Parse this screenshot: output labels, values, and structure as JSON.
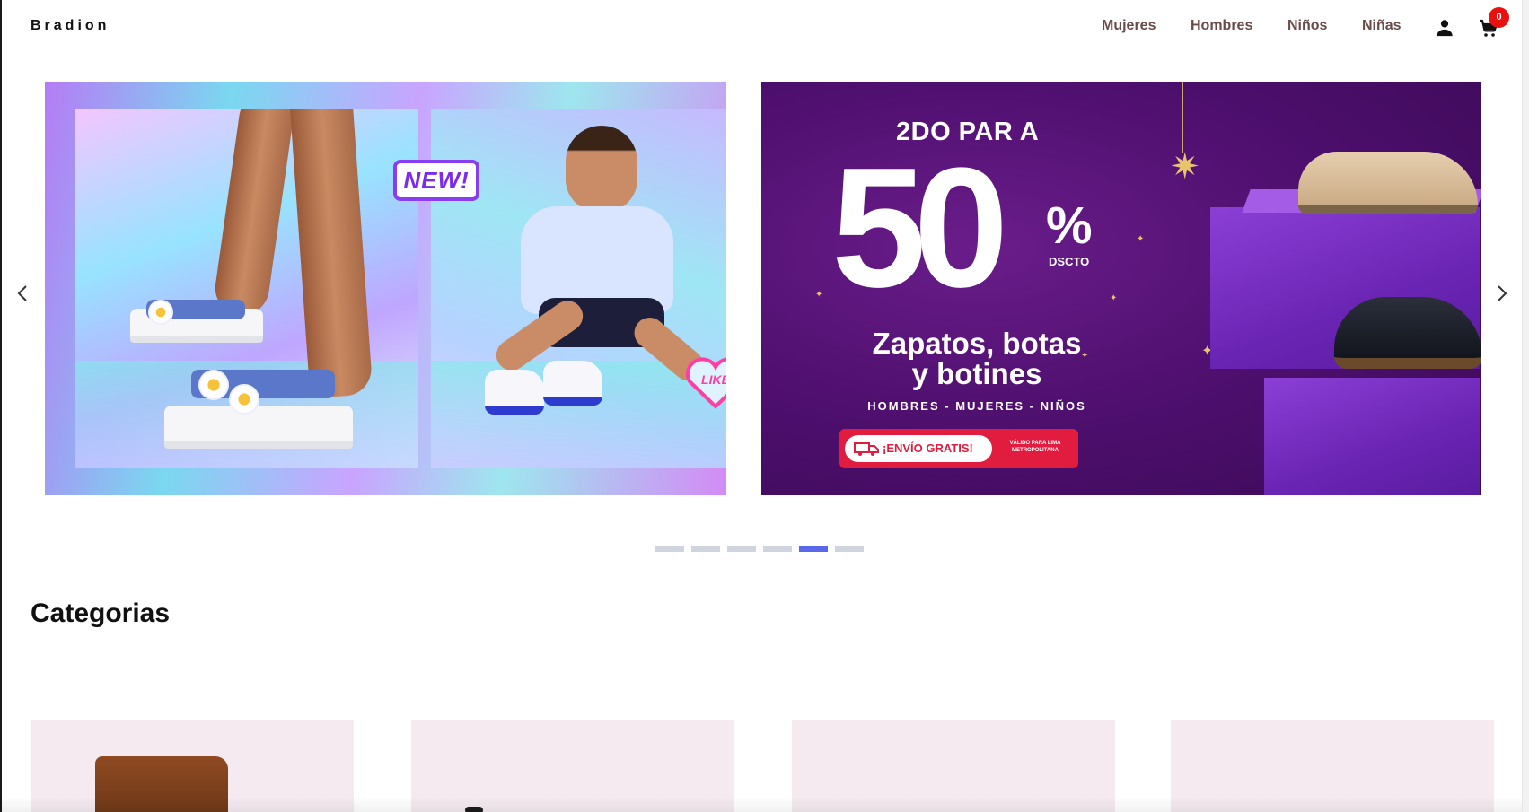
{
  "brand": {
    "logo": "Bradion"
  },
  "nav": {
    "links": [
      "Mujeres",
      "Hombres",
      "Niños",
      "Niñas"
    ],
    "user_icon": "person-icon",
    "cart_icon": "cart-icon",
    "cart_count": "0"
  },
  "carousel": {
    "prev_icon": "chevron-left-icon",
    "next_icon": "chevron-right-icon",
    "active_index": 4,
    "dot_count": 6,
    "slide1": {
      "badge_new": "NEW!",
      "badge_like": "LIKE"
    },
    "slide2": {
      "headline": "2DO PAR A",
      "big_number": "50",
      "percent": "%",
      "dscto": "DSCTO",
      "subtitle_line1": "Zapatos, botas",
      "subtitle_line2": "y botines",
      "categories_line": "HOMBRES - MUJERES - NIÑOS",
      "shipping_label": "¡ENVÍO GRATIS!",
      "shipping_note": "VÁLIDO PARA LIMA METROPOLITANA"
    }
  },
  "categories": {
    "title": "Categorias"
  },
  "colors": {
    "accent": "#5a67e8",
    "badge": "#e91010",
    "nav_text": "#6b4a4a",
    "promo_purple": "#4e0f6e",
    "promo_red": "#e11c3e"
  }
}
